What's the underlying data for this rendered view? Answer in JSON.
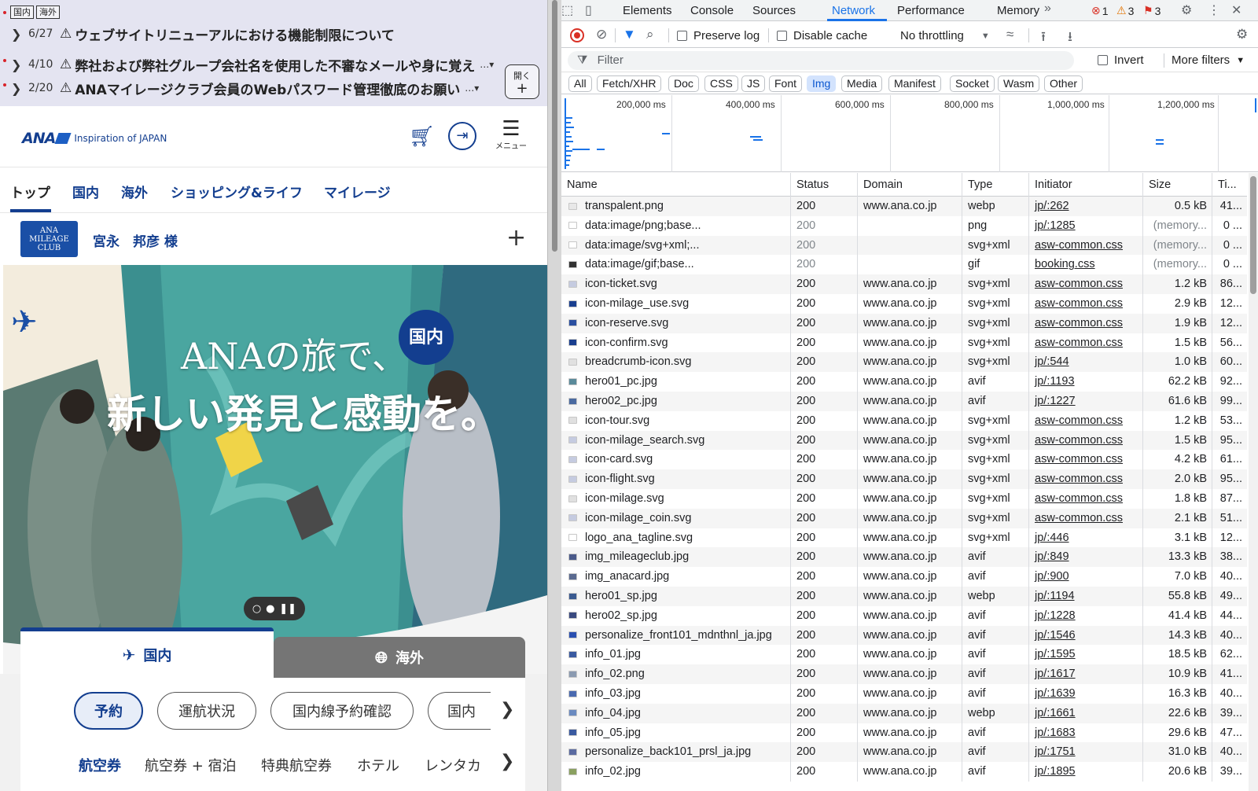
{
  "site": {
    "notice": {
      "tags": [
        "国内",
        "海外"
      ],
      "items": [
        {
          "date": "6/27",
          "title": "ウェブサイトリニューアルにおける機能制限について",
          "more": ""
        },
        {
          "date": "4/10",
          "title": "弊社および弊社グループ会社名を使用した不審なメールや身に覚え",
          "more": "…▾"
        },
        {
          "date": "2/20",
          "title": "ANAマイレージクラブ会員のWebパスワード管理徹底のお願い",
          "more": "…▾"
        }
      ],
      "open_label": "開く"
    },
    "header": {
      "logo": "ANA",
      "tagline": "Inspiration of JAPAN",
      "menu_label": "メニュー"
    },
    "nav": [
      "トップ",
      "国内",
      "海外",
      "ショッピング&ライフ",
      "マイレージ"
    ],
    "member": {
      "club_logo": "ANA MILEAGE CLUB",
      "name": "宮永　邦彦 様"
    },
    "hero": {
      "line1": "ANAの旅で、",
      "line2": "新しい発見と感動を。",
      "badge": "国内"
    },
    "booking": {
      "tabs": [
        "国内",
        "海外"
      ],
      "pills": [
        "予約",
        "運航状況",
        "国内線予約確認",
        "国内"
      ],
      "sub": [
        "航空券",
        "航空券 + 宿泊",
        "特典航空券",
        "ホテル",
        "レンタカ"
      ]
    }
  },
  "devtools": {
    "tabs": [
      "Elements",
      "Console",
      "Sources",
      "Network",
      "Performance",
      "Memory"
    ],
    "active_tab": "Network",
    "counts": {
      "errors": "1",
      "warnings": "3",
      "issues": "3"
    },
    "toolbar": {
      "preserve_log": "Preserve log",
      "disable_cache": "Disable cache",
      "throttling": "No throttling"
    },
    "filter": {
      "placeholder": "Filter",
      "invert": "Invert",
      "more_filters": "More filters"
    },
    "types": [
      "All",
      "Fetch/XHR",
      "Doc",
      "CSS",
      "JS",
      "Font",
      "Img",
      "Media",
      "Manifest",
      "Socket",
      "Wasm",
      "Other"
    ],
    "active_type": "Img",
    "overview_ticks": [
      "200,000 ms",
      "400,000 ms",
      "600,000 ms",
      "800,000 ms",
      "1,000,000 ms",
      "1,200,000 ms"
    ],
    "columns": [
      "Name",
      "Status",
      "Domain",
      "Type",
      "Initiator",
      "Size",
      "Ti..."
    ],
    "rows": [
      {
        "name": "transpalent.png",
        "status": "200",
        "domain": "www.ana.co.jp",
        "type": "webp",
        "initiator": "jp/:262",
        "size": "0.5 kB",
        "time": "41...",
        "icon": "#e8e8e8"
      },
      {
        "name": "data:image/png;base...",
        "status": "200",
        "domain": "",
        "type": "png",
        "initiator": "jp/:1285",
        "size": "(memory...",
        "time": "0 ...",
        "icon": "#ffffff"
      },
      {
        "name": "data:image/svg+xml;...",
        "status": "200",
        "domain": "",
        "type": "svg+xml",
        "initiator": "asw-common.css",
        "size": "(memory...",
        "time": "0 ...",
        "icon": "#ffffff"
      },
      {
        "name": "data:image/gif;base...",
        "status": "200",
        "domain": "",
        "type": "gif",
        "initiator": "booking.css",
        "size": "(memory...",
        "time": "0 ...",
        "icon": "#333333"
      },
      {
        "name": "icon-ticket.svg",
        "status": "200",
        "domain": "www.ana.co.jp",
        "type": "svg+xml",
        "initiator": "asw-common.css",
        "size": "1.2 kB",
        "time": "86...",
        "icon": "#c5cbe0"
      },
      {
        "name": "icon-milage_use.svg",
        "status": "200",
        "domain": "www.ana.co.jp",
        "type": "svg+xml",
        "initiator": "asw-common.css",
        "size": "2.9 kB",
        "time": "12...",
        "icon": "#1a3f8f"
      },
      {
        "name": "icon-reserve.svg",
        "status": "200",
        "domain": "www.ana.co.jp",
        "type": "svg+xml",
        "initiator": "asw-common.css",
        "size": "1.9 kB",
        "time": "12...",
        "icon": "#2a4fa0"
      },
      {
        "name": "icon-confirm.svg",
        "status": "200",
        "domain": "www.ana.co.jp",
        "type": "svg+xml",
        "initiator": "asw-common.css",
        "size": "1.5 kB",
        "time": "56...",
        "icon": "#1a3f8f"
      },
      {
        "name": "breadcrumb-icon.svg",
        "status": "200",
        "domain": "www.ana.co.jp",
        "type": "svg+xml",
        "initiator": "jp/:544",
        "size": "1.0 kB",
        "time": "60...",
        "icon": "#e0e0e0"
      },
      {
        "name": "hero01_pc.jpg",
        "status": "200",
        "domain": "www.ana.co.jp",
        "type": "avif",
        "initiator": "jp/:1193",
        "size": "62.2 kB",
        "time": "92...",
        "icon": "#5a8a9a"
      },
      {
        "name": "hero02_pc.jpg",
        "status": "200",
        "domain": "www.ana.co.jp",
        "type": "avif",
        "initiator": "jp/:1227",
        "size": "61.6 kB",
        "time": "99...",
        "icon": "#4a6aa0"
      },
      {
        "name": "icon-tour.svg",
        "status": "200",
        "domain": "www.ana.co.jp",
        "type": "svg+xml",
        "initiator": "asw-common.css",
        "size": "1.2 kB",
        "time": "53...",
        "icon": "#e0e0e0"
      },
      {
        "name": "icon-milage_search.svg",
        "status": "200",
        "domain": "www.ana.co.jp",
        "type": "svg+xml",
        "initiator": "asw-common.css",
        "size": "1.5 kB",
        "time": "95...",
        "icon": "#c5cbe0"
      },
      {
        "name": "icon-card.svg",
        "status": "200",
        "domain": "www.ana.co.jp",
        "type": "svg+xml",
        "initiator": "asw-common.css",
        "size": "4.2 kB",
        "time": "61...",
        "icon": "#c5cbe0"
      },
      {
        "name": "icon-flight.svg",
        "status": "200",
        "domain": "www.ana.co.jp",
        "type": "svg+xml",
        "initiator": "asw-common.css",
        "size": "2.0 kB",
        "time": "95...",
        "icon": "#c5cbe0"
      },
      {
        "name": "icon-milage.svg",
        "status": "200",
        "domain": "www.ana.co.jp",
        "type": "svg+xml",
        "initiator": "asw-common.css",
        "size": "1.8 kB",
        "time": "87...",
        "icon": "#e0e0e0"
      },
      {
        "name": "icon-milage_coin.svg",
        "status": "200",
        "domain": "www.ana.co.jp",
        "type": "svg+xml",
        "initiator": "asw-common.css",
        "size": "2.1 kB",
        "time": "51...",
        "icon": "#c5cbe0"
      },
      {
        "name": "logo_ana_tagline.svg",
        "status": "200",
        "domain": "www.ana.co.jp",
        "type": "svg+xml",
        "initiator": "jp/:446",
        "size": "3.1 kB",
        "time": "12...",
        "icon": "#ffffff"
      },
      {
        "name": "img_mileageclub.jpg",
        "status": "200",
        "domain": "www.ana.co.jp",
        "type": "avif",
        "initiator": "jp/:849",
        "size": "13.3 kB",
        "time": "38...",
        "icon": "#4a5a8a"
      },
      {
        "name": "img_anacard.jpg",
        "status": "200",
        "domain": "www.ana.co.jp",
        "type": "avif",
        "initiator": "jp/:900",
        "size": "7.0 kB",
        "time": "40...",
        "icon": "#5a6a90"
      },
      {
        "name": "hero01_sp.jpg",
        "status": "200",
        "domain": "www.ana.co.jp",
        "type": "webp",
        "initiator": "jp/:1194",
        "size": "55.8 kB",
        "time": "49...",
        "icon": "#3a5a90"
      },
      {
        "name": "hero02_sp.jpg",
        "status": "200",
        "domain": "www.ana.co.jp",
        "type": "avif",
        "initiator": "jp/:1228",
        "size": "41.4 kB",
        "time": "44...",
        "icon": "#3a4a80"
      },
      {
        "name": "personalize_front101_mdnthnl_ja.jpg",
        "status": "200",
        "domain": "www.ana.co.jp",
        "type": "avif",
        "initiator": "jp/:1546",
        "size": "14.3 kB",
        "time": "40...",
        "icon": "#2a4fb0"
      },
      {
        "name": "info_01.jpg",
        "status": "200",
        "domain": "www.ana.co.jp",
        "type": "avif",
        "initiator": "jp/:1595",
        "size": "18.5 kB",
        "time": "62...",
        "icon": "#3a5aa0"
      },
      {
        "name": "info_02.png",
        "status": "200",
        "domain": "www.ana.co.jp",
        "type": "avif",
        "initiator": "jp/:1617",
        "size": "10.9 kB",
        "time": "41...",
        "icon": "#8a9ab0"
      },
      {
        "name": "info_03.jpg",
        "status": "200",
        "domain": "www.ana.co.jp",
        "type": "avif",
        "initiator": "jp/:1639",
        "size": "16.3 kB",
        "time": "40...",
        "icon": "#4a6ab0"
      },
      {
        "name": "info_04.jpg",
        "status": "200",
        "domain": "www.ana.co.jp",
        "type": "webp",
        "initiator": "jp/:1661",
        "size": "22.6 kB",
        "time": "39...",
        "icon": "#6a8ac0"
      },
      {
        "name": "info_05.jpg",
        "status": "200",
        "domain": "www.ana.co.jp",
        "type": "avif",
        "initiator": "jp/:1683",
        "size": "29.6 kB",
        "time": "47...",
        "icon": "#3a5aa0"
      },
      {
        "name": "personalize_back101_prsl_ja.jpg",
        "status": "200",
        "domain": "www.ana.co.jp",
        "type": "avif",
        "initiator": "jp/:1751",
        "size": "31.0 kB",
        "time": "40...",
        "icon": "#5a6aa0"
      },
      {
        "name": "info_02.jpg",
        "status": "200",
        "domain": "www.ana.co.jp",
        "type": "avif",
        "initiator": "jp/:1895",
        "size": "20.6 kB",
        "time": "39...",
        "icon": "#8aa060"
      }
    ]
  }
}
